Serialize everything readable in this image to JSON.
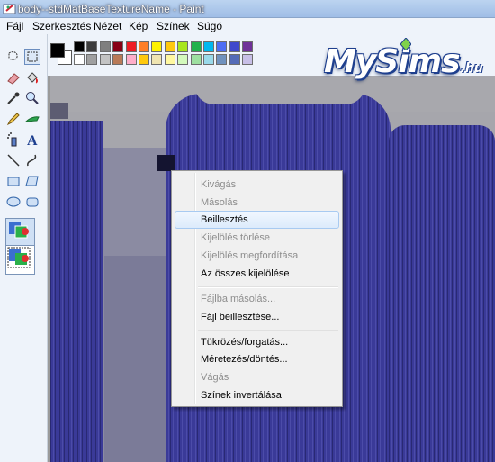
{
  "window": {
    "title": "body--stdMatBaseTextureName - Paint"
  },
  "menu": {
    "items": [
      "Fájl",
      "Szerkesztés",
      "Nézet",
      "Kép",
      "Színek",
      "Súgó"
    ]
  },
  "palette": {
    "foreground": "#000000",
    "background": "#ffffff",
    "row1": [
      "#000000",
      "#808080",
      "#800000",
      "#808000",
      "#008000",
      "#008080",
      "#000080",
      "#800080",
      "#808040",
      "#004040",
      "#0080ff",
      "#004080",
      "#8000ff",
      "#804000"
    ],
    "row1_actual": [
      "#000000",
      "#3c3c3c",
      "#7f7f7f",
      "#880015",
      "#ed1c24",
      "#ff7f27",
      "#fff200",
      "#ffc90e",
      "#a8e61d",
      "#22b14c",
      "#00b7ef",
      "#4d6df3",
      "#3f48cc",
      "#6f3198"
    ],
    "row2_actual": [
      "#ffffff",
      "#a0a0a0",
      "#c3c3c3",
      "#b97a57",
      "#ffaec9",
      "#ffc90e",
      "#efe4b0",
      "#fff8a0",
      "#d3f9bc",
      "#9ddfa0",
      "#99d9ea",
      "#7092be",
      "#546bb7",
      "#c8bfe7"
    ]
  },
  "logo": {
    "main": "MySims",
    "suffix": ".hu"
  },
  "context_menu": {
    "items": [
      {
        "label": "Kivágás",
        "enabled": false
      },
      {
        "label": "Másolás",
        "enabled": false
      },
      {
        "label": "Beillesztés",
        "enabled": true,
        "highlighted": true
      },
      {
        "label": "Kijelölés törlése",
        "enabled": false
      },
      {
        "label": "Kijelölés megfordítása",
        "enabled": false
      },
      {
        "label": "Az összes kijelölése",
        "enabled": true
      },
      {
        "label": "Fájlba másolás...",
        "enabled": false
      },
      {
        "label": "Fájl beillesztése...",
        "enabled": true
      },
      {
        "label": "Tükrözés/forgatás...",
        "enabled": true
      },
      {
        "label": "Méretezés/döntés...",
        "enabled": true
      },
      {
        "label": "Vágás",
        "enabled": false
      },
      {
        "label": "Színek invertálása",
        "enabled": true
      }
    ]
  },
  "tools": [
    "free-form-select",
    "select",
    "eraser",
    "fill",
    "color-picker",
    "magnifier",
    "pencil",
    "brush",
    "airbrush",
    "text",
    "line",
    "curve",
    "rectangle",
    "polygon",
    "ellipse",
    "rounded-rectangle"
  ]
}
